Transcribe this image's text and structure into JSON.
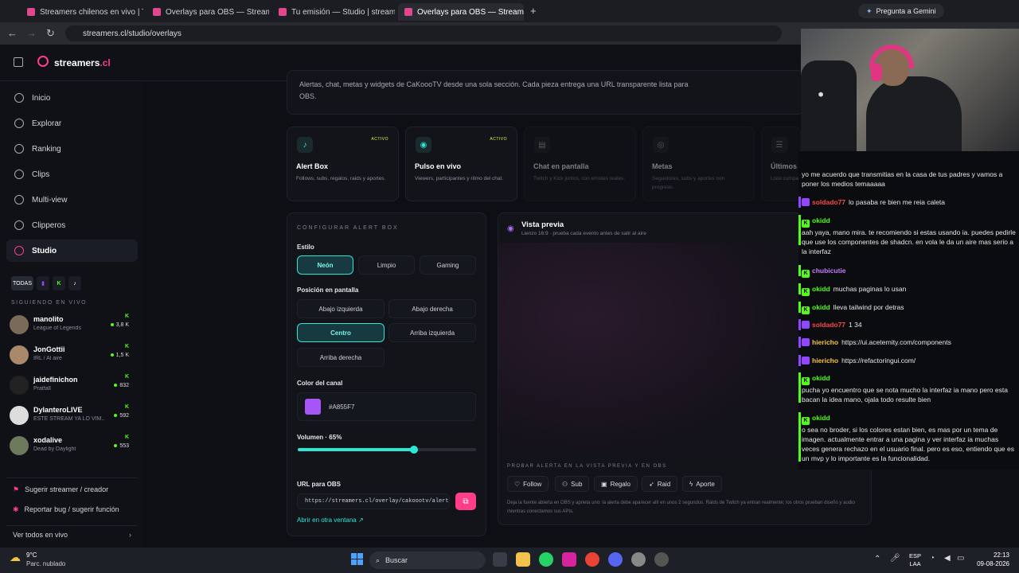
{
  "browser": {
    "tabs": [
      {
        "label": "Streamers chilenos en vivo | Tw"
      },
      {
        "label": "Overlays para OBS — Streamer"
      },
      {
        "label": "Tu emisión — Studio | streame"
      },
      {
        "label": "Overlays para OBS — Streamer"
      }
    ],
    "gemini_label": "Pregunta a Gemini",
    "url": "streamers.cl/studio/overlays"
  },
  "app": {
    "logo": "streamers",
    "logo_suffix": ".cl",
    "nav": [
      {
        "label": "Inicio",
        "icon": "home-icon"
      },
      {
        "label": "Explorar",
        "icon": "compass-icon"
      },
      {
        "label": "Ranking",
        "icon": "trophy-icon"
      },
      {
        "label": "Clips",
        "icon": "clip-icon"
      },
      {
        "label": "Multi-view",
        "icon": "grid-icon"
      },
      {
        "label": "Clipperos",
        "icon": "users-icon"
      },
      {
        "label": "Studio",
        "icon": "broadcast-icon"
      }
    ],
    "filters": [
      "TODAS",
      "K"
    ],
    "following_title": "SIGUIENDO EN VIVO",
    "streamers": [
      {
        "name": "manolito",
        "game": "League of Legends",
        "platform": "K",
        "viewers": "3,8 K"
      },
      {
        "name": "JonGottii",
        "game": "IRL / Al aire",
        "platform": "K",
        "viewers": "1,5 K"
      },
      {
        "name": "jaidefinichon",
        "game": "Pratfall",
        "platform": "K",
        "viewers": "832"
      },
      {
        "name": "DylanteroLIVE",
        "game": "ESTE STREAM YA LO VIM...",
        "platform": "K",
        "viewers": "592"
      },
      {
        "name": "xodalive",
        "game": "Dead by Daylight",
        "platform": "K",
        "viewers": "553"
      }
    ],
    "suggest_label": "Sugerir streamer / creador",
    "report_label": "Reportar bug / sugerir función",
    "see_all_label": "Ver todos en vivo"
  },
  "main": {
    "intro": "Alertas, chat, metas y widgets de CaKoooTV desde una sola sección. Cada pieza entrega una URL transparente lista para OBS.",
    "widgets": [
      {
        "title": "Alert Box",
        "desc": "Follows, subs, regalos, raids y aportes.",
        "status": "ACTIVO"
      },
      {
        "title": "Pulso en vivo",
        "desc": "Viewers, participantes y ritmo del chat.",
        "status": "ACTIVO"
      },
      {
        "title": "Chat en pantalla",
        "desc": "Twitch y Kick juntos, con emotes reales.",
        "status": ""
      },
      {
        "title": "Metas",
        "desc": "Seguidores, subs y aportes con progreso.",
        "status": ""
      },
      {
        "title": "Últimos eventos",
        "desc": "Lista compacta",
        "status": ""
      }
    ],
    "config": {
      "title": "CONFIGURAR ALERT BOX",
      "style_label": "Estilo",
      "styles": [
        "Neón",
        "Limpio",
        "Gaming"
      ],
      "selected_style": "Neón",
      "position_label": "Posición en pantalla",
      "positions": [
        "Abajo izquierda",
        "Abajo derecha",
        "Centro",
        "Arriba izquierda",
        "Arriba derecha"
      ],
      "selected_position": "Centro",
      "color_label": "Color del canal",
      "color": "#A855F7",
      "volume_label": "Volumen · 65%",
      "volume": 0.65,
      "url_label": "URL para OBS",
      "url_value": "https://streamers.cl/overlay/cakoootv/alerts",
      "open_label": "Abrir en otra ventana"
    },
    "preview": {
      "title": "Vista previa",
      "subtitle": "Lienzo 16:9 · prueba cada evento antes de salir al aire",
      "test_label": "PROBAR ALERTA EN LA VISTA PREVIA Y EN OBS",
      "actions": [
        "Follow",
        "Sub",
        "Regalo",
        "Raid",
        "Aporte"
      ],
      "note": "Deja la fuente abierta en OBS y aprieta uno: la alerta debe aparecer allí en unos 2 segundos. Raids de Twitch ya entran realmente; los otros prueban diseño y audio mientras conectamos sus APIs."
    }
  },
  "chat": [
    {
      "user": "",
      "platform": "",
      "text": "yo me acuerdo que transmitias en la casa de tus padres y vamos a poner los medios temaaaaa"
    },
    {
      "user": "soldado77",
      "platform": "twitch",
      "text": "lo pasaba re bien me reia caleta"
    },
    {
      "user": "okidd",
      "platform": "kick",
      "text": "aah yaya, mano mira. te recomiendo si estas usando ia. puedes pedirle que use los componentes de shadcn. en vola le da un aire mas serio a la interfaz"
    },
    {
      "user": "chubicutie",
      "platform": "kick",
      "text": ""
    },
    {
      "user": "okidd",
      "platform": "kick",
      "text": "muchas paginas lo usan"
    },
    {
      "user": "okidd",
      "platform": "kick",
      "text": "lleva tailwind por detras"
    },
    {
      "user": "soldado77",
      "platform": "twitch",
      "text": "1 34"
    },
    {
      "user": "hiericho",
      "platform": "twitch",
      "text": "https://ui.aceternity.com/components"
    },
    {
      "user": "hiericho",
      "platform": "twitch",
      "text": "https://refactoringui.com/"
    },
    {
      "user": "okidd",
      "platform": "kick",
      "text": "pucha yo encuentro que se nota mucho la interfaz ia mano pero esta bacan la idea mano, ojala todo resulte bien"
    },
    {
      "user": "okidd",
      "platform": "kick",
      "text": "o sea no broder, si los colores estan bien, es mas por un tema de imagen. actualmente entrar a una pagina y ver interfaz ia muchas veces genera rechazo en el usuario final. pero es eso, entiendo que es un mvp y lo importante es la funcionalidad."
    }
  ],
  "taskbar": {
    "weather_temp": "9°C",
    "weather_desc": "Parc. nublado",
    "search_label": "Buscar",
    "lang": "ESP",
    "lang2": "LAA",
    "time": "22:13",
    "date": "09-08-2026"
  },
  "colors": {
    "accent": "#ff3d8b",
    "teal": "#2ee6d6",
    "kick": "#53fc18",
    "twitch": "#9146ff"
  }
}
